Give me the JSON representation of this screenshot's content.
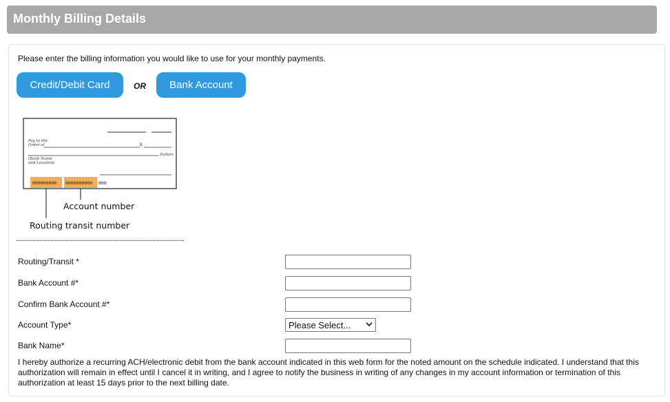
{
  "header": {
    "title": "Monthly Billing Details"
  },
  "intro": "Please enter the billing information you would like to use for your monthly payments.",
  "payment_methods": {
    "card_label": "Credit/Debit Card",
    "or_label": "OR",
    "bank_label": "Bank Account"
  },
  "check_diagram": {
    "pay_to_line1": "Pay to the",
    "pay_to_line2": "Order of",
    "dollar_sign": "$",
    "dollars": "Dollars",
    "bank_name_line1": "(Bank Name",
    "bank_name_line2": "and Location)",
    "routing_digits": "000000000",
    "account_digits": "0000000000",
    "check_digits": "000",
    "account_caption": "Account number",
    "routing_caption": "Routing transit number"
  },
  "form": {
    "routing_label": "Routing/Transit *",
    "account_label": "Bank Account #*",
    "confirm_label": "Confirm Bank Account #*",
    "type_label": "Account Type*",
    "type_selected": "Please Select...",
    "bank_name_label": "Bank Name*"
  },
  "authorization": "I hereby authorize a recurring ACH/electronic debit from the bank account indicated in this web form for the noted amount on the schedule indicated. I understand that this authorization will remain in effect until I cancel it in writing, and I agree to notify the business in writing of any changes in my account information or termination of this authorization at least 15 days prior to the next billing date.",
  "colors": {
    "header_bg": "#a8a8a8",
    "button_bg": "#2f9adf",
    "micr_highlight": "#f0b05a"
  },
  "icons": {
    "select_arrow": "chevron-down-icon"
  }
}
